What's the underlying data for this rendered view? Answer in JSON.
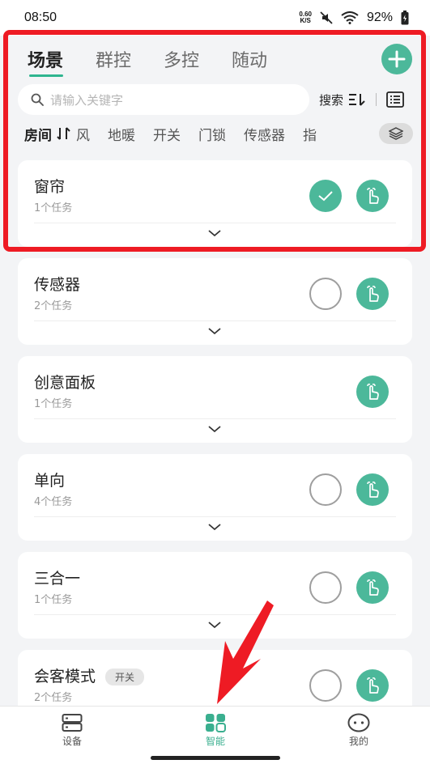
{
  "status_bar": {
    "time": "08:50",
    "net_speed_value": "0.60",
    "net_speed_unit": "K/S",
    "battery": "92%"
  },
  "top_tabs": [
    "场景",
    "群控",
    "多控",
    "随动"
  ],
  "search": {
    "placeholder": "请输入关键字",
    "button_label": "搜索"
  },
  "filter": {
    "active": "房间",
    "items": [
      "风",
      "地暖",
      "开关",
      "门锁",
      "传感器",
      "指"
    ]
  },
  "cards": [
    {
      "title": "窗帘",
      "subtitle": "1个任务",
      "badge": "",
      "selected": true,
      "has_select": true
    },
    {
      "title": "传感器",
      "subtitle": "2个任务",
      "badge": "",
      "selected": false,
      "has_select": true
    },
    {
      "title": "创意面板",
      "subtitle": "1个任务",
      "badge": "",
      "selected": false,
      "has_select": false
    },
    {
      "title": "单向",
      "subtitle": "4个任务",
      "badge": "",
      "selected": false,
      "has_select": true
    },
    {
      "title": "三合一",
      "subtitle": "1个任务",
      "badge": "",
      "selected": false,
      "has_select": true
    },
    {
      "title": "会客模式",
      "subtitle": "2个任务",
      "badge": "开关",
      "selected": false,
      "has_select": true
    }
  ],
  "bottom_nav": [
    {
      "label": "设备",
      "icon": "device-icon"
    },
    {
      "label": "智能",
      "icon": "smart-icon"
    },
    {
      "label": "我的",
      "icon": "profile-icon"
    }
  ],
  "colors": {
    "accent": "#4cb89a",
    "highlight": "#ee1b24"
  }
}
